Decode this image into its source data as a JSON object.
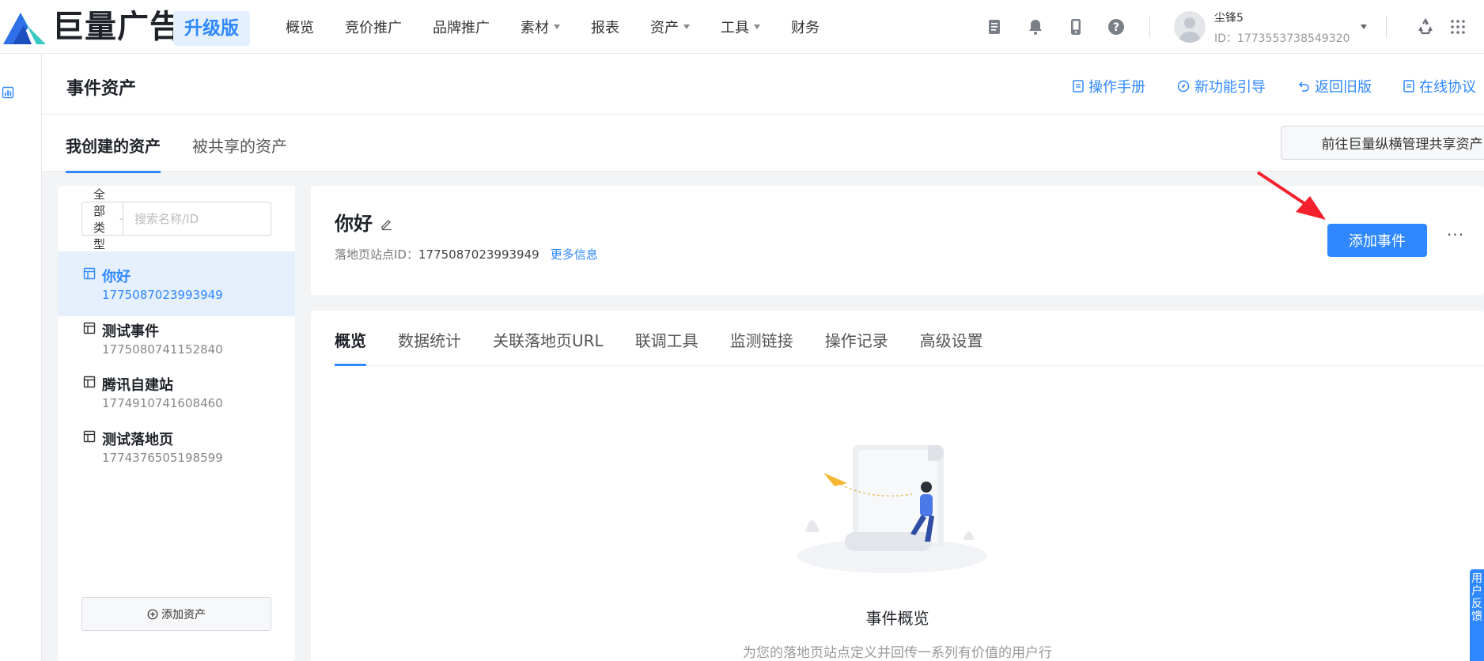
{
  "brand": {
    "name": "巨量广告",
    "badge": "升级版"
  },
  "nav": {
    "items": [
      {
        "label": "概览"
      },
      {
        "label": "竞价推广"
      },
      {
        "label": "品牌推广"
      },
      {
        "label": "素材",
        "dropdown": true
      },
      {
        "label": "报表"
      },
      {
        "label": "资产",
        "dropdown": true
      },
      {
        "label": "工具",
        "dropdown": true
      },
      {
        "label": "财务"
      }
    ]
  },
  "user": {
    "name": "尘锋5",
    "id": "ID：1773553738549320"
  },
  "page": {
    "title": "事件资产",
    "links": [
      {
        "label": "操作手册",
        "icon": "document-icon"
      },
      {
        "label": "新功能引导",
        "icon": "compass-icon"
      },
      {
        "label": "返回旧版",
        "icon": "undo-icon"
      },
      {
        "label": "在线协议",
        "icon": "document-icon"
      }
    ]
  },
  "asset_tabs": {
    "mine": "我创建的资产",
    "shared": "被共享的资产",
    "share_button": "前往巨量纵横管理共享资产"
  },
  "list": {
    "filter_type": "全部类型",
    "search_placeholder": "搜索名称/ID",
    "add_button": "添加资产",
    "items": [
      {
        "name": "你好",
        "id": "1775087023993949",
        "selected": true
      },
      {
        "name": "测试事件",
        "id": "1775080741152840"
      },
      {
        "name": "腾讯自建站",
        "id": "1774910741608460"
      },
      {
        "name": "测试落地页",
        "id": "1774376505198599"
      }
    ]
  },
  "detail": {
    "title": "你好",
    "meta_label": "落地页站点ID：",
    "meta_id": "1775087023993949",
    "more_link": "更多信息",
    "add_event_button": "添加事件",
    "ellipsis": "···"
  },
  "tabs": [
    {
      "label": "概览",
      "active": true
    },
    {
      "label": "数据统计"
    },
    {
      "label": "关联落地页URL"
    },
    {
      "label": "联调工具"
    },
    {
      "label": "监测链接"
    },
    {
      "label": "操作记录"
    },
    {
      "label": "高级设置"
    }
  ],
  "overview": {
    "title": "事件概览",
    "desc": "为您的落地页站点定义并回传一系列有价值的用户行"
  },
  "feedback": {
    "label": "用户反馈"
  },
  "colors": {
    "accent": "#2f88ff",
    "selected_bg": "#e6f0fd",
    "arrow": "#f5222d"
  }
}
